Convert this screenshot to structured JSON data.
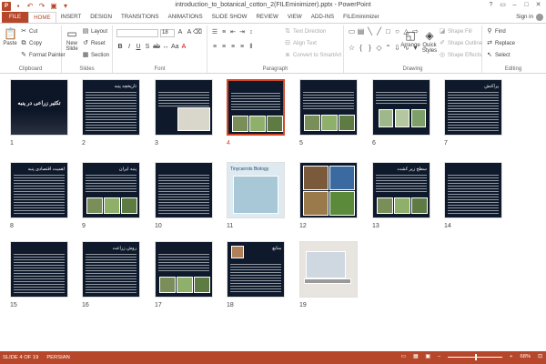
{
  "window": {
    "title": "introduction_to_botanical_cotton_2(FILEminimizer).pptx - PowerPoint",
    "app_icon": "P",
    "controls": [
      "?",
      "▭",
      "–",
      "□",
      "✕"
    ]
  },
  "tabs": {
    "file": "FILE",
    "items": [
      "HOME",
      "INSERT",
      "DESIGN",
      "TRANSITIONS",
      "ANIMATIONS",
      "SLIDE SHOW",
      "REVIEW",
      "VIEW",
      "ADD-INS",
      "FILEminimizer"
    ],
    "active": "HOME",
    "signin": "Sign in"
  },
  "ribbon": {
    "clipboard": {
      "label": "Clipboard",
      "paste": "Paste",
      "cut": "Cut",
      "copy": "Copy",
      "format_painter": "Format Painter"
    },
    "slides": {
      "label": "Slides",
      "new_slide": "New",
      "new_slide_2": "Slide",
      "layout": "Layout",
      "reset": "Reset",
      "section": "Section"
    },
    "font": {
      "label": "Font",
      "size": "18"
    },
    "paragraph": {
      "label": "Paragraph",
      "text_direction": "Text Direction",
      "align_text": "Align Text",
      "convert": "Convert to SmartArt"
    },
    "drawing": {
      "label": "Drawing",
      "arrange": "Arrange",
      "quick_styles": "Quick",
      "quick_styles_2": "Styles",
      "shape_fill": "Shape Fill",
      "shape_outline": "Shape Outline",
      "shape_effects": "Shape Effects"
    },
    "editing": {
      "label": "Editing",
      "find": "Find",
      "replace": "Replace",
      "select": "Select"
    }
  },
  "slides": [
    {
      "n": "1",
      "title": "تکثیر زراعی در پنبه",
      "kind": "title"
    },
    {
      "n": "2",
      "title": "تاریخچه پنبه",
      "kind": "text"
    },
    {
      "n": "3",
      "title": "",
      "kind": "text-pic"
    },
    {
      "n": "4",
      "title": "",
      "kind": "text-pics",
      "selected": true
    },
    {
      "n": "5",
      "title": "",
      "kind": "text-pics"
    },
    {
      "n": "6",
      "title": "",
      "kind": "pics"
    },
    {
      "n": "7",
      "title": "پراکنش",
      "kind": "text"
    },
    {
      "n": "8",
      "title": "اهمیت اقتصادی پنبه",
      "kind": "text"
    },
    {
      "n": "9",
      "title": "پنبه ایران",
      "kind": "text-pics"
    },
    {
      "n": "10",
      "title": "",
      "kind": "text"
    },
    {
      "n": "11",
      "title": "Tinycarrots Biology",
      "kind": "map"
    },
    {
      "n": "12",
      "title": "",
      "kind": "photos"
    },
    {
      "n": "13",
      "title": "سطح زیر کشت",
      "kind": "text-pics"
    },
    {
      "n": "14",
      "title": "",
      "kind": "text"
    },
    {
      "n": "15",
      "title": "",
      "kind": "text"
    },
    {
      "n": "16",
      "title": "روش زراعت",
      "kind": "text"
    },
    {
      "n": "17",
      "title": "",
      "kind": "text-pics"
    },
    {
      "n": "18",
      "title": "منابع",
      "kind": "refs"
    },
    {
      "n": "19",
      "title": "",
      "kind": "laptop"
    }
  ],
  "status": {
    "slide_of": "SLIDE 4 OF 19",
    "language": "PERSIAN",
    "zoom": "68%"
  },
  "colors": {
    "accent": "#b7472a",
    "slide_bg": "#0e1a2c",
    "selection": "#d24726"
  }
}
